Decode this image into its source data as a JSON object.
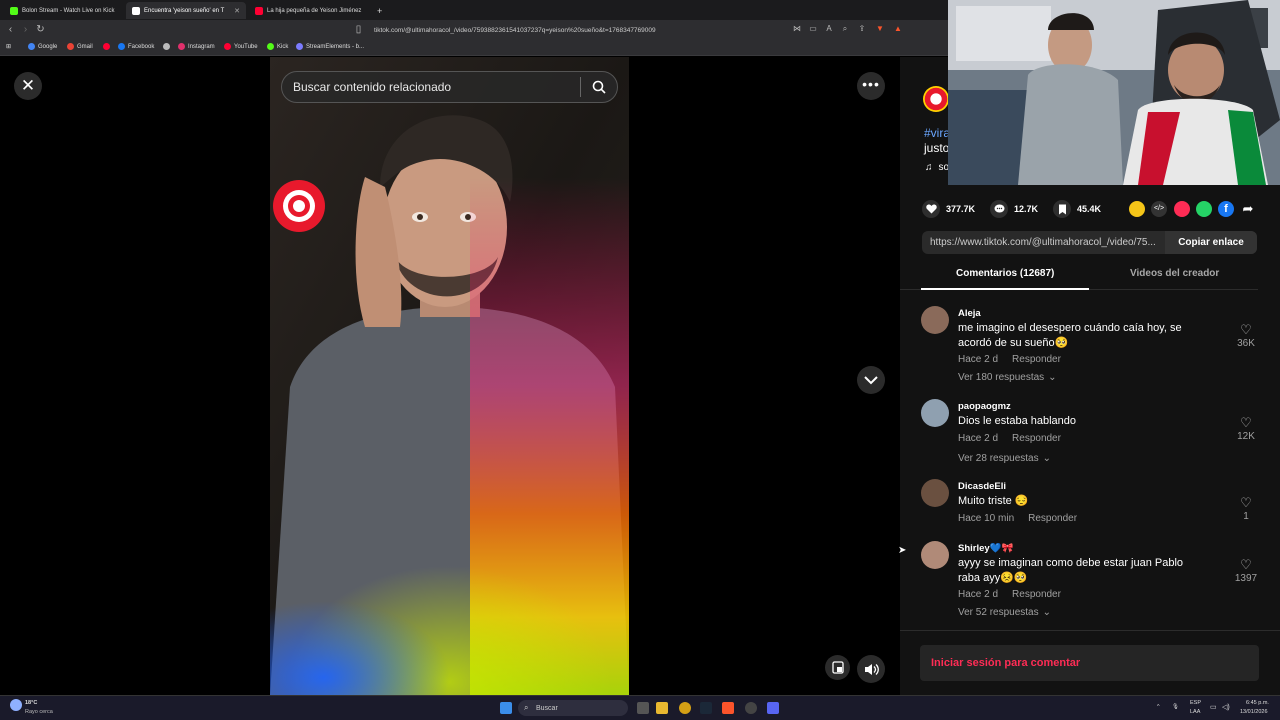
{
  "browser": {
    "tabs": [
      {
        "title": "Bolon Stream - Watch Live on Kick",
        "active": false,
        "favicon_color": "#53fc18"
      },
      {
        "title": "Encuentra 'yeison sueño' en T",
        "active": true,
        "favicon_color": "#ffffff"
      },
      {
        "title": "La hija pequeña de Yeison Jiménez",
        "active": false,
        "favicon_color": "#ff0033"
      }
    ],
    "new_tab_label": "+",
    "url": "tiktok.com/@ultimahoracol_/video/7593882361541037237q=yeison%20sueño&t=1768347769009",
    "bookmarks": [
      {
        "label": "Google",
        "color": "#4285f4"
      },
      {
        "label": "Gmail",
        "color": "#ea4335"
      },
      {
        "label": "",
        "color": "#ff0033"
      },
      {
        "label": "Facebook",
        "color": "#1877f2"
      },
      {
        "label": "",
        "color": "#bbbbbb"
      },
      {
        "label": "Instagram",
        "color": "#e1306c"
      },
      {
        "label": "YouTube",
        "color": "#ff0033"
      },
      {
        "label": "Kick",
        "color": "#53fc18"
      },
      {
        "label": "StreamElements - b...",
        "color": "#7b7bff"
      }
    ]
  },
  "viewer": {
    "close_label": "✕",
    "search_placeholder": "Buscar contenido relacionado",
    "more_label": "•••"
  },
  "post": {
    "hashtag_fragment": "#vira",
    "caption_fragment": "justo",
    "sound_fragment": "so",
    "likes": "377.7K",
    "comments": "12.7K",
    "saves": "45.4K",
    "share_colors": [
      "#f5c518",
      "#333333",
      "#fe2c55",
      "#25d366",
      "#1877f2"
    ],
    "link": "https://www.tiktok.com/@ultimahoracol_/video/75...",
    "copy_label": "Copiar enlace"
  },
  "panel_tabs": {
    "comments_tab": "Comentarios (12687)",
    "creator_tab": "Videos del creador"
  },
  "comments": [
    {
      "user": "Aleja",
      "text": "me imagino el desespero cuándo caía hoy, se acordó de su sueño🥺",
      "time": "Hace 2 d",
      "reply": "Responder",
      "replies": "Ver 180 respuestas",
      "likes": "36K",
      "avatar_color": "#8a6a5a"
    },
    {
      "user": "paopaogmz",
      "text": "Dios le estaba hablando",
      "time": "Hace 2 d",
      "reply": "Responder",
      "replies": "Ver 28 respuestas",
      "likes": "12K",
      "avatar_color": "#8fa0b0"
    },
    {
      "user": "DicasdeEli",
      "text": "Muito triste 😔",
      "time": "Hace 10 min",
      "reply": "Responder",
      "replies": "",
      "likes": "1",
      "avatar_color": "#6a5040"
    },
    {
      "user": "Shirley💙🎀",
      "text": "ayyy se imaginan como debe estar juan Pablo raba ayy😣🥺",
      "time": "Hace 2 d",
      "reply": "Responder",
      "replies": "Ver 52 respuestas",
      "likes": "1397",
      "avatar_color": "#b08a78"
    }
  ],
  "login_prompt": "Iniciar sesión para comentar",
  "taskbar": {
    "weather_temp": "18°C",
    "weather_desc": "Rayo cerca",
    "search_label": "Buscar",
    "lang_top": "ESP",
    "lang_bottom": "LAA",
    "time": "6:45 p.m.",
    "date": "13/01/2026"
  }
}
